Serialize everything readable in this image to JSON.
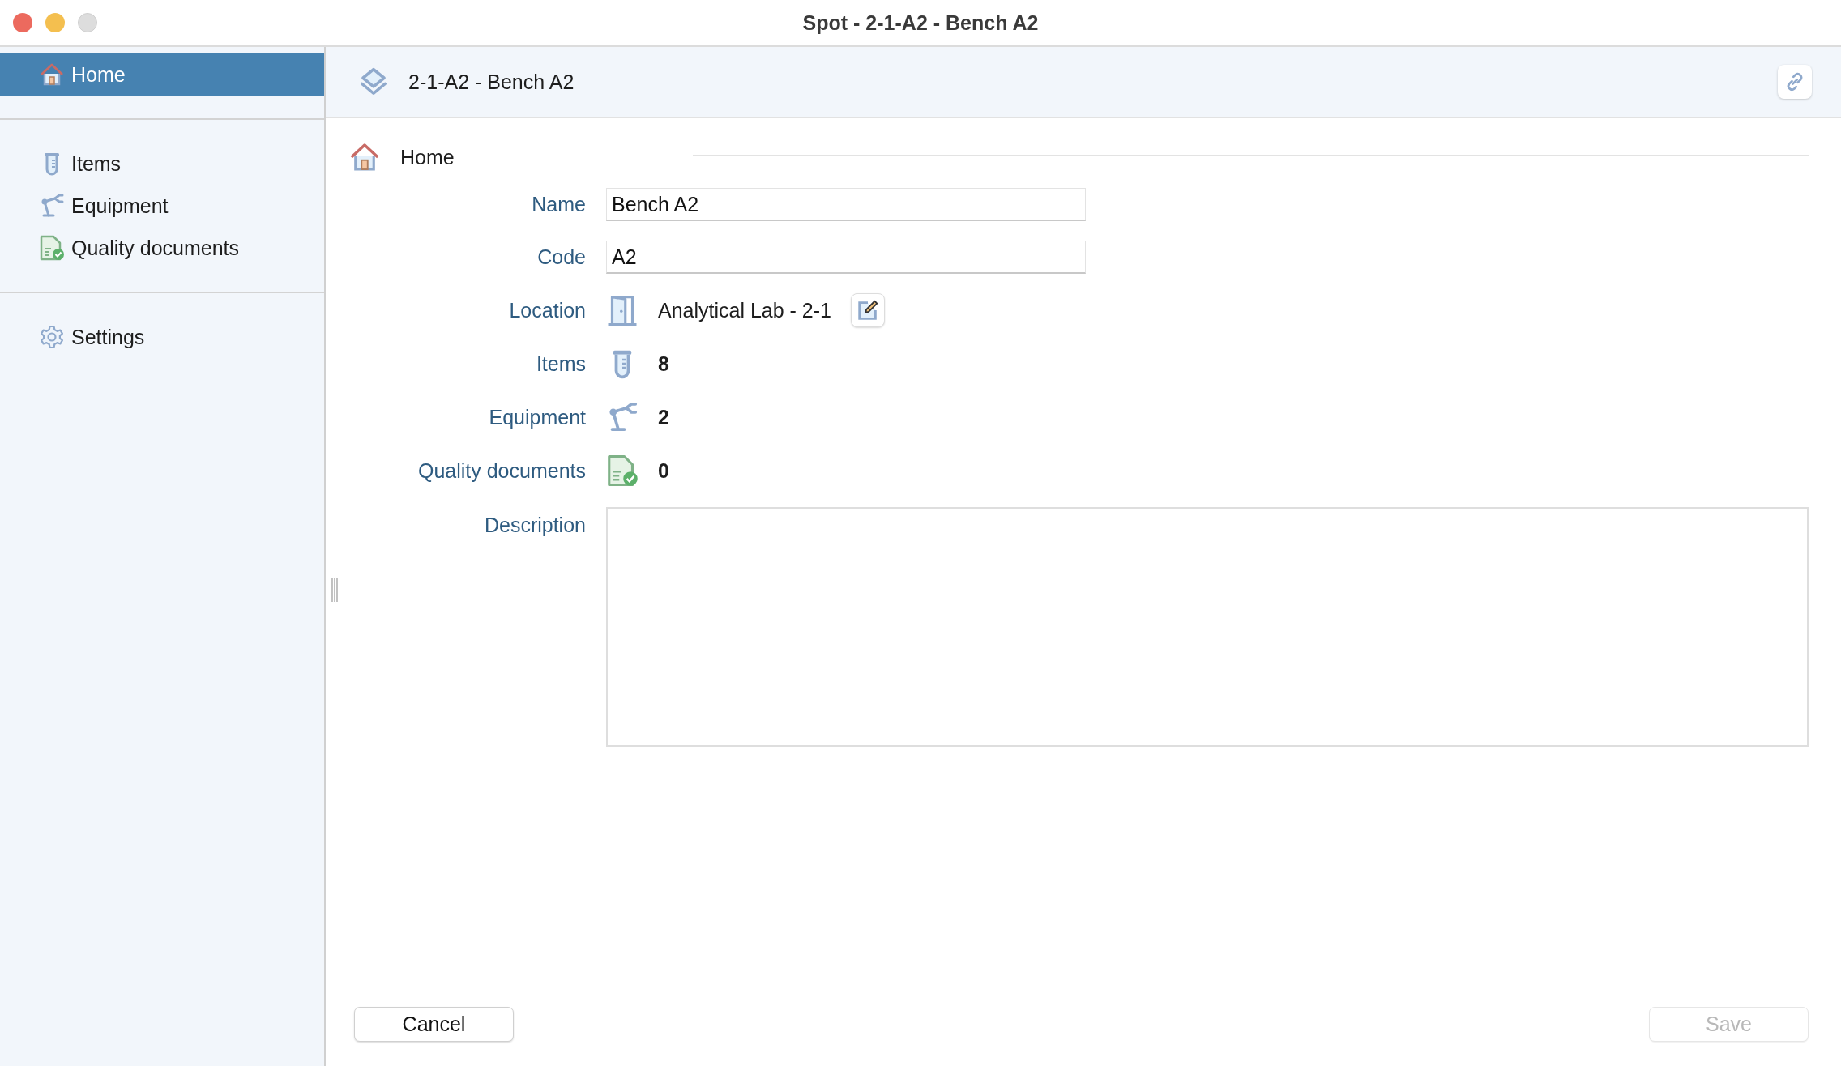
{
  "window": {
    "title": "Spot - 2-1-A2 - Bench A2"
  },
  "sidebar": {
    "groups": [
      {
        "items": [
          {
            "label": "Home",
            "selected": true
          }
        ]
      },
      {
        "items": [
          {
            "label": "Items",
            "selected": false
          },
          {
            "label": "Equipment",
            "selected": false
          },
          {
            "label": "Quality documents",
            "selected": false
          }
        ]
      },
      {
        "items": [
          {
            "label": "Settings",
            "selected": false
          }
        ]
      }
    ]
  },
  "header": {
    "title": "2-1-A2 - Bench A2"
  },
  "section": {
    "title": "Home"
  },
  "form": {
    "name": {
      "label": "Name",
      "value": "Bench A2"
    },
    "code": {
      "label": "Code",
      "value": "A2"
    },
    "location": {
      "label": "Location",
      "value": "Analytical Lab - 2-1"
    },
    "counts": [
      {
        "label": "Items",
        "value": "8"
      },
      {
        "label": "Equipment",
        "value": "2"
      },
      {
        "label": "Quality documents",
        "value": "0"
      }
    ],
    "description": {
      "label": "Description"
    }
  },
  "buttons": {
    "cancel": {
      "label": "Cancel",
      "disabled": false
    },
    "save": {
      "label": "Save",
      "disabled": true
    }
  }
}
